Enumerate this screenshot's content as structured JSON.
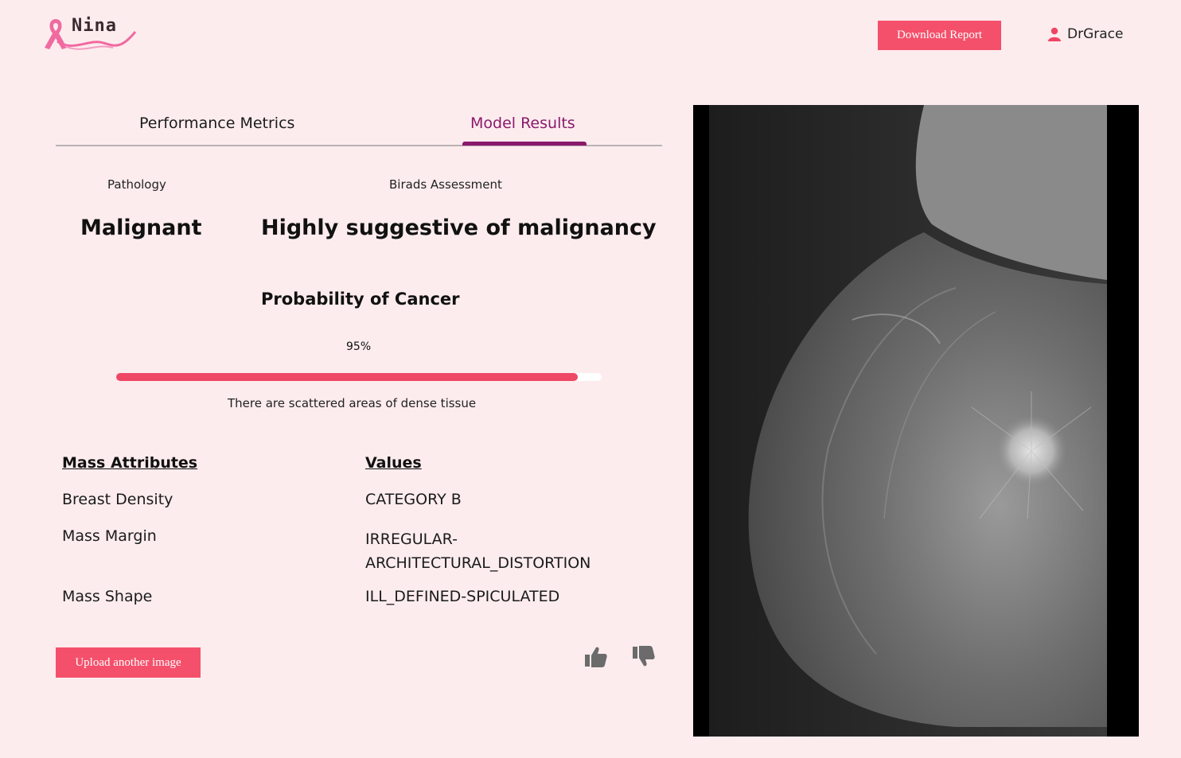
{
  "header": {
    "logo_text": "Nina",
    "download_label": "Download Report",
    "user_name": "DrGrace"
  },
  "tabs": [
    {
      "label": "Performance Metrics",
      "active": false
    },
    {
      "label": "Model Results",
      "active": true
    }
  ],
  "results": {
    "pathology_label": "Pathology",
    "pathology_value": "Malignant",
    "birads_label": "Birads Assessment",
    "birads_value": "Highly suggestive of malignancy",
    "probability_title": "Probability of Cancer",
    "probability_text": "95%",
    "probability_fraction": 0.95,
    "density_note": "There are scattered areas of dense tissue"
  },
  "mass_table": {
    "header_attr": "Mass Attributes",
    "header_value": "Values",
    "rows": [
      {
        "attr": "Breast Density",
        "value": "CATEGORY B"
      },
      {
        "attr": "Mass Margin",
        "value": "IRREGULAR-ARCHITECTURAL_DISTORTION"
      },
      {
        "attr": "Mass Shape",
        "value": "ILL_DEFINED-SPICULATED"
      }
    ]
  },
  "actions": {
    "upload_label": "Upload another image"
  },
  "colors": {
    "accent": "#f4506b",
    "tab_active": "#8a1a6b",
    "background": "#fdecee"
  },
  "icons": {
    "logo": "pink-ribbon-icon",
    "user": "user-icon",
    "like": "thumbs-up-icon",
    "dislike": "thumbs-down-icon"
  }
}
